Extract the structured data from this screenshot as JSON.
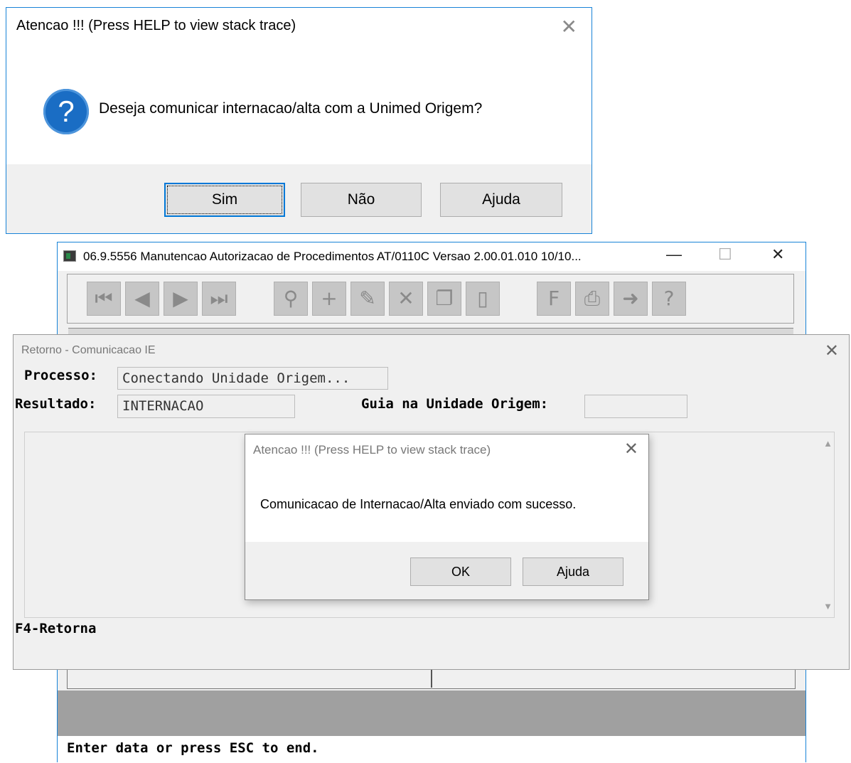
{
  "dialog_question": {
    "title": "Atencao !!! (Press HELP to view stack trace)",
    "close_glyph": "✕",
    "icon_name": "question-icon",
    "message": "Deseja comunicar internacao/alta com a Unimed Origem?",
    "buttons": {
      "yes": "Sim",
      "no": "Não",
      "help": "Ajuda"
    }
  },
  "main_window": {
    "title": "06.9.5556 Manutencao Autorizacao de Procedimentos AT/0110C Versao 2.00.01.010 10/10...",
    "controls": {
      "minimize": "—",
      "maximize": "☐",
      "close": "✕"
    },
    "toolbar_icons": [
      "first-record-icon",
      "previous-record-icon",
      "next-record-icon",
      "last-record-icon",
      "search-icon",
      "add-icon",
      "edit-icon",
      "delete-icon",
      "copy-icon",
      "exit-door-icon",
      "filter-icon",
      "print-icon",
      "return-icon",
      "help-icon"
    ],
    "status_text": "Enter data or press ESC to end."
  },
  "retorno_window": {
    "title": "Retorno - Comunicacao IE",
    "close_glyph": "✕",
    "processo_label": "Processo:",
    "processo_value": "Conectando Unidade Origem...",
    "resultado_label": "Resultado:",
    "resultado_value": "INTERNACAO",
    "guia_label": "Guia na Unidade Origem:",
    "guia_value": "",
    "footer_hint": "F4-Retorna"
  },
  "dialog_success": {
    "title": "Atencao !!!  (Press HELP to view stack trace)",
    "close_glyph": "✕",
    "message": "Comunicacao de Internacao/Alta enviado com sucesso.",
    "buttons": {
      "ok": "OK",
      "help": "Ajuda"
    }
  },
  "colors": {
    "accent": "#0078d7",
    "window_border": "#1883d7",
    "dialog_footer": "#f0f0f0",
    "question_icon": "#1a6dc4"
  }
}
